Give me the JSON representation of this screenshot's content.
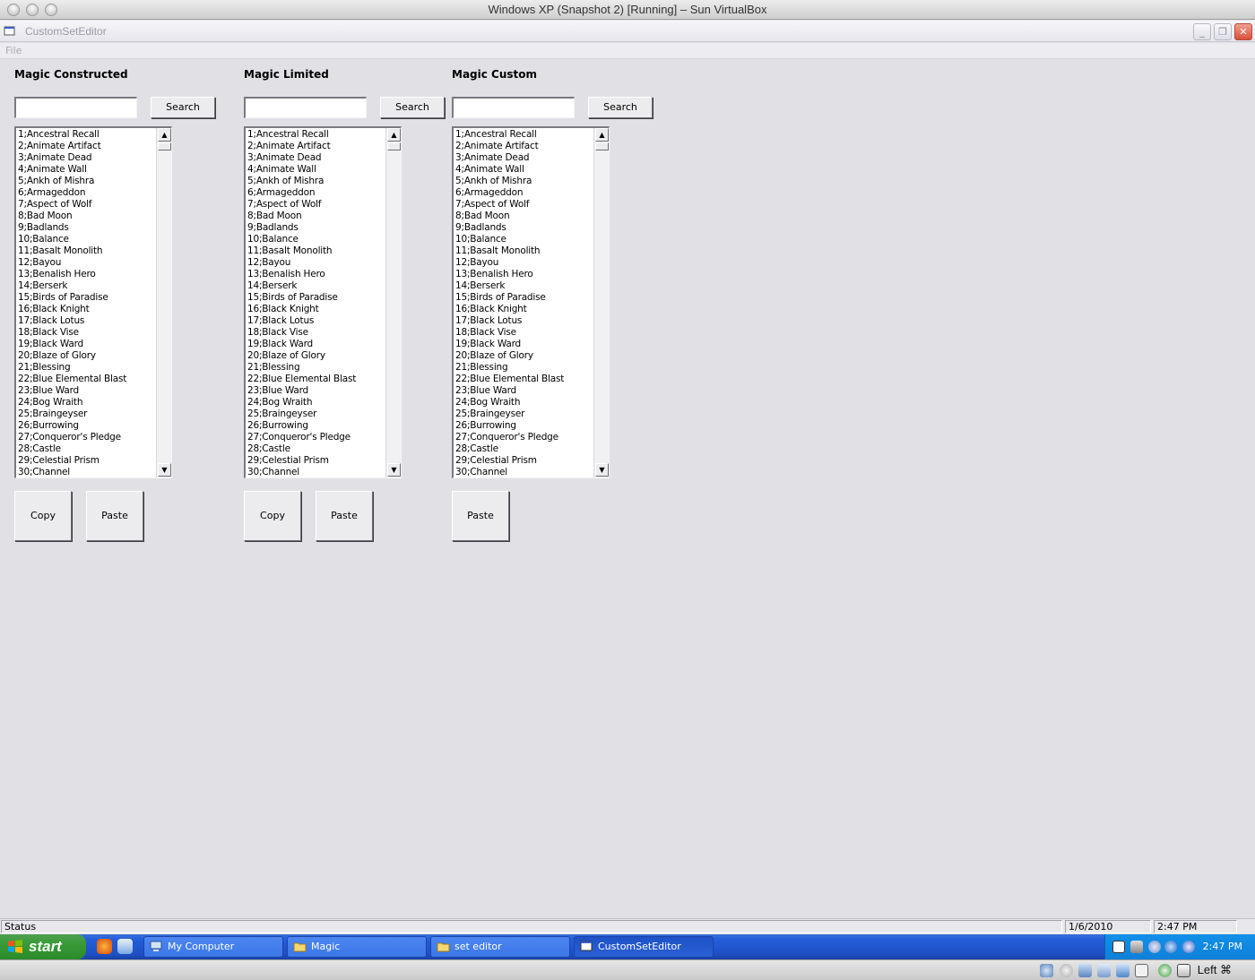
{
  "host": {
    "window_title": "Windows XP (Snapshot 2) [Running] – Sun VirtualBox",
    "host_key": "Left ⌘"
  },
  "app": {
    "title": "CustomSetEditor",
    "menu": {
      "file": "File"
    }
  },
  "panels": [
    {
      "title": "Magic Constructed",
      "search_value": "",
      "search_label": "Search",
      "actions": [
        "Copy",
        "Paste"
      ]
    },
    {
      "title": "Magic Limited",
      "search_value": "",
      "search_label": "Search",
      "actions": [
        "Copy",
        "Paste"
      ]
    },
    {
      "title": "Magic Custom",
      "search_value": "",
      "search_label": "Search",
      "actions": [
        "Paste"
      ]
    }
  ],
  "cards": [
    "1;Ancestral Recall",
    "2;Animate Artifact",
    "3;Animate Dead",
    "4;Animate Wall",
    "5;Ankh of Mishra",
    "6;Armageddon",
    "7;Aspect of Wolf",
    "8;Bad Moon",
    "9;Badlands",
    "10;Balance",
    "11;Basalt Monolith",
    "12;Bayou",
    "13;Benalish Hero",
    "14;Berserk",
    "15;Birds of Paradise",
    "16;Black Knight",
    "17;Black Lotus",
    "18;Black Vise",
    "19;Black Ward",
    "20;Blaze of Glory",
    "21;Blessing",
    "22;Blue Elemental Blast",
    "23;Blue Ward",
    "24;Bog Wraith",
    "25;Braingeyser",
    "26;Burrowing",
    "27;Conqueror's Pledge",
    "28;Castle",
    "29;Celestial Prism",
    "30;Channel"
  ],
  "statusbar": {
    "status": "Status",
    "date": "1/6/2010",
    "time": "2:47 PM"
  },
  "taskbar": {
    "start": "start",
    "tasks": [
      "My Computer",
      "Magic",
      "set editor",
      "CustomSetEditor"
    ],
    "clock": "2:47 PM"
  }
}
